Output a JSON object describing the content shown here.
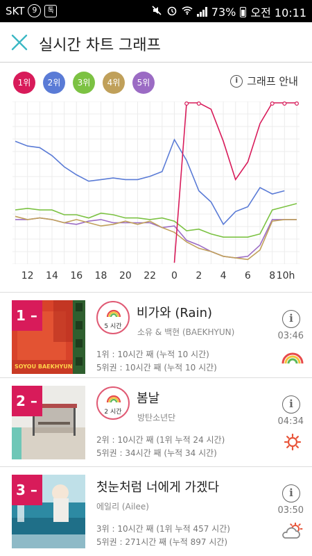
{
  "status_bar": {
    "carrier": "SKT",
    "badge1": "9",
    "badge2": "톡",
    "battery": "73%",
    "time": "오전 10:11"
  },
  "header": {
    "title": "실시간 차트 그래프",
    "close_icon": "close-icon"
  },
  "legend": {
    "items": [
      {
        "label": "1위",
        "color": "#d81b5a"
      },
      {
        "label": "2위",
        "color": "#5a7bd6"
      },
      {
        "label": "3위",
        "color": "#7cc243"
      },
      {
        "label": "4위",
        "color": "#c0a05a"
      },
      {
        "label": "5위",
        "color": "#9b6bc4"
      }
    ],
    "guide_label": "그래프 안내"
  },
  "chart_data": {
    "type": "line",
    "x": [
      "11",
      "12",
      "13",
      "14",
      "15",
      "16",
      "17",
      "18",
      "19",
      "20",
      "21",
      "22",
      "23",
      "0",
      "1",
      "2",
      "3",
      "4",
      "5",
      "6",
      "7",
      "8",
      "9",
      "10"
    ],
    "tick_labels": [
      "12",
      "14",
      "16",
      "18",
      "20",
      "22",
      "0",
      "2",
      "4",
      "6",
      "8",
      "10h"
    ],
    "grid": true,
    "series": [
      {
        "color": "#d81b5a",
        "values": [
          null,
          null,
          null,
          null,
          null,
          null,
          null,
          null,
          null,
          null,
          null,
          null,
          null,
          0,
          100,
          100,
          96,
          76,
          52,
          63,
          87,
          100,
          100,
          100
        ]
      },
      {
        "color": "#5a7bd6",
        "values": [
          76,
          73,
          72,
          67,
          60,
          55,
          51,
          52,
          53,
          52,
          52,
          54,
          57,
          77,
          64,
          45,
          38,
          24,
          32,
          35,
          47,
          43,
          45,
          null
        ]
      },
      {
        "color": "#7cc243",
        "values": [
          33,
          34,
          33,
          33,
          30,
          30,
          28,
          31,
          30,
          28,
          28,
          27,
          28,
          26,
          20,
          21,
          18,
          16,
          16,
          16,
          18,
          33,
          35,
          37
        ]
      },
      {
        "color": "#c0a05a",
        "values": [
          29,
          27,
          28,
          27,
          25,
          27,
          25,
          23,
          24,
          26,
          24,
          26,
          22,
          19,
          13,
          9,
          7,
          4,
          3,
          2,
          8,
          26,
          27,
          27
        ]
      },
      {
        "color": "#9b6bc4",
        "values": [
          27,
          27,
          28,
          27,
          25,
          24,
          26,
          27,
          25,
          25,
          25,
          25,
          22,
          23,
          14,
          11,
          7,
          4,
          3,
          4,
          11,
          27,
          27,
          27
        ]
      }
    ]
  },
  "songs": [
    {
      "rank": "1",
      "hours_label": "5 시간",
      "title": "비가와 (Rain)",
      "artist": "소유 & 백현 (BAEKHYUN)",
      "stat1": "1위 : 10시간 째 (누적 10 시간)",
      "stat2": "5위권 : 10시간 째 (누적 10 시간)",
      "duration": "03:46",
      "weather_icon": "rainbow-icon",
      "cover_text": "SOYOU  BAEKHYUN"
    },
    {
      "rank": "2",
      "hours_label": "2 시간",
      "title": "봄날",
      "artist": "방탄소년단",
      "stat1": "2위 : 10시간 째 (1위 누적 24 시간)",
      "stat2": "5위권 : 34시간 째 (누적 34 시간)",
      "duration": "04:34",
      "weather_icon": "sun-icon"
    },
    {
      "rank": "3",
      "title": "첫눈처럼 너에게 가겠다",
      "artist": "에일리 (Ailee)",
      "stat1": "3위 : 10시간 째 (1위 누적 457 시간)",
      "stat2": "5위권 : 271시간 째 (누적 897 시간)",
      "duration": "03:50",
      "weather_icon": "partly-cloudy-icon"
    }
  ]
}
